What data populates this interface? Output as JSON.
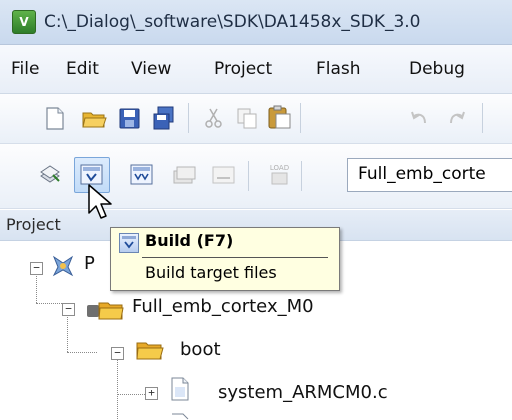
{
  "window": {
    "title": "C:\\_Dialog\\_software\\SDK\\DA1458x_SDK_3.0",
    "app_icon_text": "V"
  },
  "menu": {
    "items": [
      "File",
      "Edit",
      "View",
      "Project",
      "Flash",
      "Debug"
    ]
  },
  "toolbar2": {
    "target_select_value": "Full_emb_corte"
  },
  "project_pane": {
    "header": "Project",
    "tree": {
      "root_label": "P",
      "target_label": "Full_emb_cortex_M0",
      "group_label": "boot",
      "file_label": "system_ARMCM0.c"
    }
  },
  "tooltip": {
    "title": "Build (F7)",
    "description": "Build target files"
  },
  "colors": {
    "title_bar": "#c9d9ee",
    "tooltip_bg": "#ffffe1",
    "folder": "#f0c040"
  }
}
